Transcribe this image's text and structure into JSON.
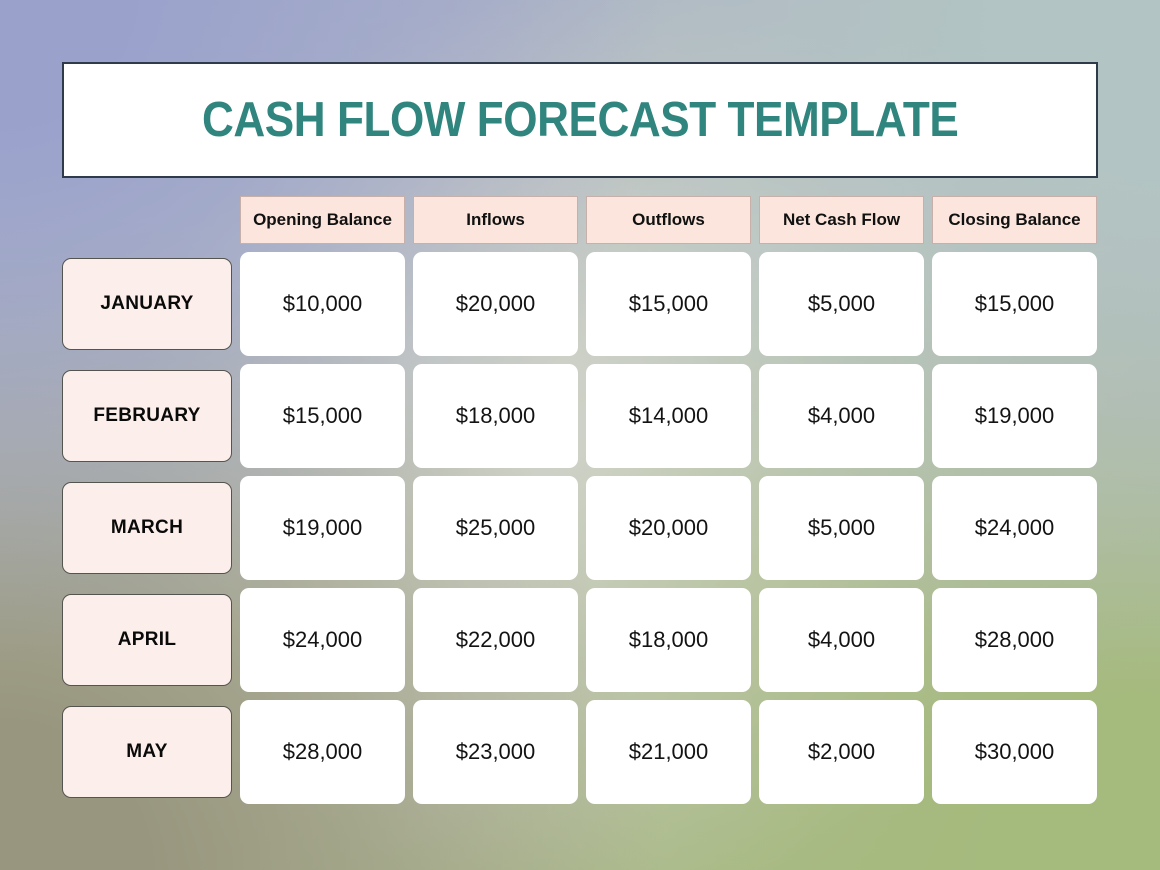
{
  "title": {
    "text": "CASH FLOW FORECAST TEMPLATE",
    "color": "#30857e"
  },
  "colors": {
    "title_teal": "#30857e",
    "header_fill": "#fbe5dc",
    "month_fill": "#fcefeb",
    "data_fill": "#ffffff",
    "text_dark": "#111111",
    "banner_border": "#2f3a4a",
    "bg_top_left": "#9aa2cc",
    "bg_top_right": "#b2c4c3",
    "bg_bottom_left": "#98967e",
    "bg_bottom_right": "#a5ba7d"
  },
  "table": {
    "row_label_header": "",
    "columns": [
      "Opening Balance",
      "Inflows",
      "Outflows",
      "Net Cash Flow",
      "Closing Balance"
    ],
    "rows": [
      {
        "month": "JANUARY",
        "opening_balance": "$10,000",
        "inflows": "$20,000",
        "outflows": "$15,000",
        "net_cash_flow": "$5,000",
        "closing_balance": "$15,000"
      },
      {
        "month": "FEBRUARY",
        "opening_balance": "$15,000",
        "inflows": "$18,000",
        "outflows": "$14,000",
        "net_cash_flow": "$4,000",
        "closing_balance": "$19,000"
      },
      {
        "month": "MARCH",
        "opening_balance": "$19,000",
        "inflows": "$25,000",
        "outflows": "$20,000",
        "net_cash_flow": "$5,000",
        "closing_balance": "$24,000"
      },
      {
        "month": "APRIL",
        "opening_balance": "$24,000",
        "inflows": "$22,000",
        "outflows": "$18,000",
        "net_cash_flow": "$4,000",
        "closing_balance": "$28,000"
      },
      {
        "month": "MAY",
        "opening_balance": "$28,000",
        "inflows": "$23,000",
        "outflows": "$21,000",
        "net_cash_flow": "$2,000",
        "closing_balance": "$30,000"
      }
    ]
  }
}
